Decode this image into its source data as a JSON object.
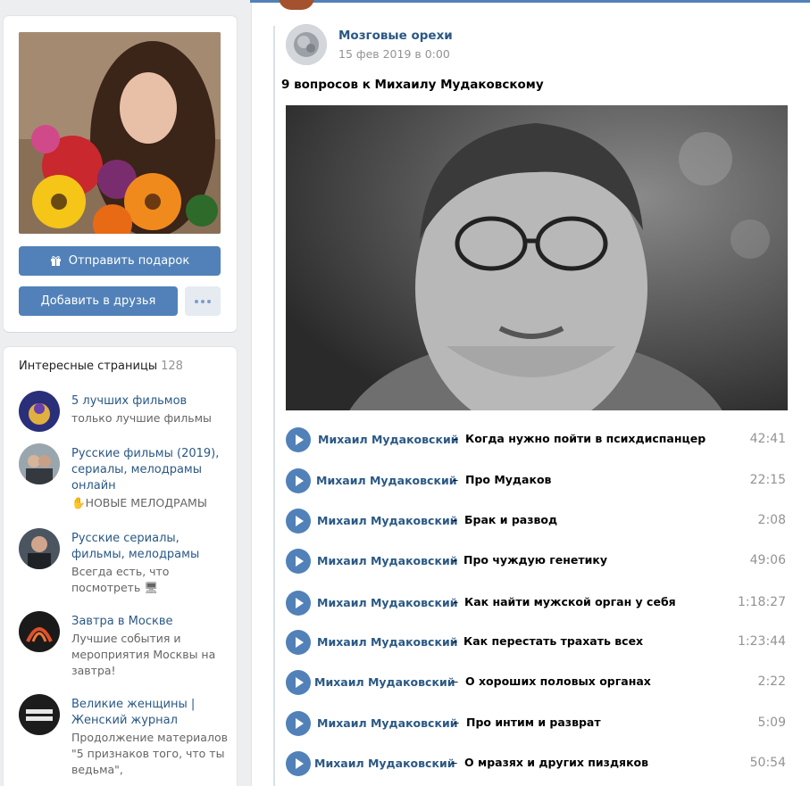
{
  "profile": {
    "gift_label": "Отправить подарок",
    "add_friend_label": "Добавить в друзья"
  },
  "pages": {
    "title": "Интересные страницы",
    "count": "128",
    "items": [
      {
        "title": "5 лучших фильмов",
        "subtitle": "только лучшие фильмы"
      },
      {
        "title": "Русские фильмы (2019), сериалы, мелодрамы онлайн",
        "subtitle": "✋НОВЫЕ МЕЛОДРАМЫ"
      },
      {
        "title": "Русские сериалы, фильмы, мелодрамы",
        "subtitle": "Всегда есть, что посмотреть 🖥"
      },
      {
        "title": "Завтра в Москве",
        "subtitle": "Лучшие события и мероприятия Москвы на завтра!"
      },
      {
        "title": "Великие женщины | Женский журнал",
        "subtitle": "Продолжение материалов \"5 признаков того, что ты ведьма\","
      }
    ]
  },
  "post": {
    "group_name": "Мозговые орехи",
    "date": "15 фев 2019 в 0:00",
    "title": "9 вопросов к Михаилу Мудаковскому",
    "tracks": [
      {
        "artist": "Михаил Мудаковский",
        "dash": "–",
        "song": "Когда нужно пойти в психдиспанцер",
        "duration": "42:41"
      },
      {
        "artist": "Михаил Мудаковский",
        "dash": "–",
        "song": "Про Мудаков",
        "duration": "22:15"
      },
      {
        "artist": "Михаил Мудаковский",
        "dash": "–",
        "song": "Брак и развод",
        "duration": "2:08"
      },
      {
        "artist": "Михаил Мудаковский",
        "dash": "–",
        "song": "Про чуждую генетику",
        "duration": "49:06"
      },
      {
        "artist": "Михаил Мудаковский",
        "dash": "–",
        "song": "Как найти мужской орган у себя",
        "duration": "1:18:27"
      },
      {
        "artist": "Михаил Мудаковский",
        "dash": "–",
        "song": "Как перестать трахать всех",
        "duration": "1:23:44"
      },
      {
        "artist": "Михаил Мудаковский",
        "dash": "–",
        "song": "О хороших половых органах",
        "duration": "2:22"
      },
      {
        "artist": "Михаил Мудаковский",
        "dash": "–",
        "song": "Про интим и разврат",
        "duration": "5:09"
      },
      {
        "artist": "Михаил Мудаковский",
        "dash": "–",
        "song": "О мразях и других пиздяков",
        "duration": "50:54"
      }
    ]
  },
  "colors": {
    "accent": "#5181b8",
    "link": "#2a5885",
    "muted": "#939393",
    "background": "#edeef0"
  }
}
